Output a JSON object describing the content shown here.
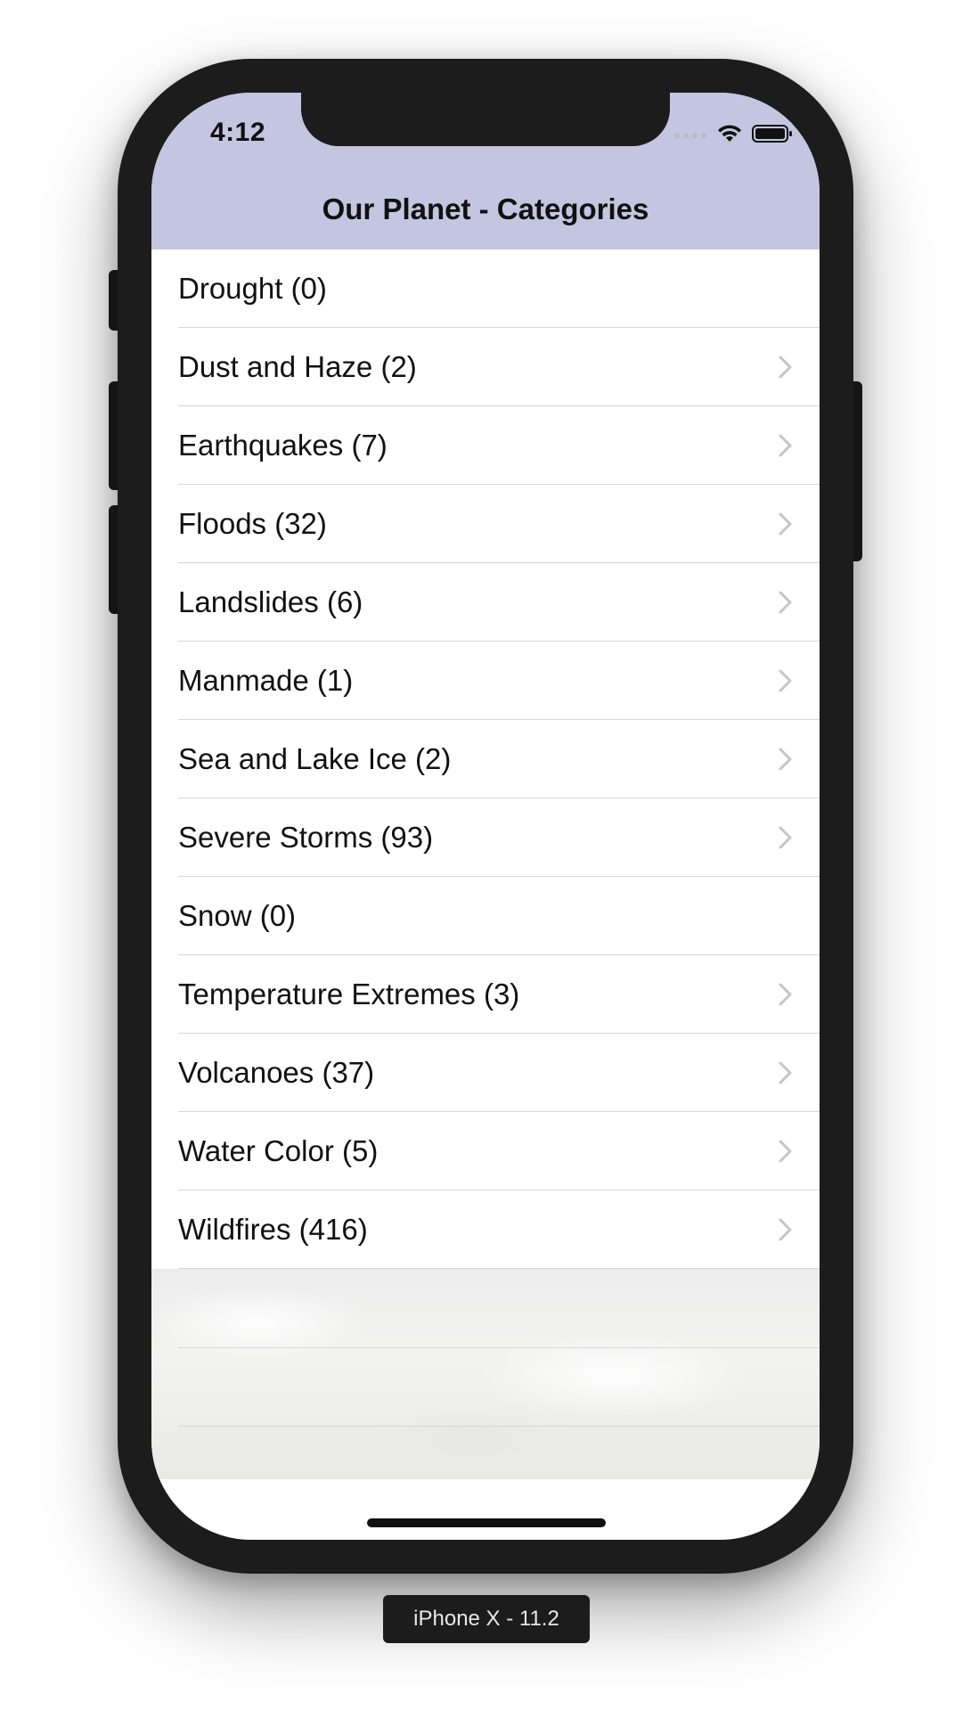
{
  "status_bar": {
    "time": "4:12"
  },
  "navbar": {
    "title": "Our Planet - Categories",
    "background": "#c4c5e0"
  },
  "categories": [
    {
      "label": "Drought (0)",
      "has_disclosure": false
    },
    {
      "label": "Dust and Haze (2)",
      "has_disclosure": true
    },
    {
      "label": "Earthquakes (7)",
      "has_disclosure": true
    },
    {
      "label": "Floods (32)",
      "has_disclosure": true
    },
    {
      "label": "Landslides (6)",
      "has_disclosure": true
    },
    {
      "label": "Manmade (1)",
      "has_disclosure": true
    },
    {
      "label": "Sea and Lake Ice (2)",
      "has_disclosure": true
    },
    {
      "label": "Severe Storms (93)",
      "has_disclosure": true
    },
    {
      "label": "Snow (0)",
      "has_disclosure": false
    },
    {
      "label": "Temperature Extremes (3)",
      "has_disclosure": true
    },
    {
      "label": "Volcanoes (37)",
      "has_disclosure": true
    },
    {
      "label": "Water Color (5)",
      "has_disclosure": true
    },
    {
      "label": "Wildfires (416)",
      "has_disclosure": true
    }
  ],
  "device": {
    "label": "iPhone X - 11.2"
  },
  "icons": {
    "status": [
      "cellular-signal-icon",
      "wifi-icon",
      "battery-icon"
    ],
    "row_accessory": "chevron-right-icon"
  }
}
